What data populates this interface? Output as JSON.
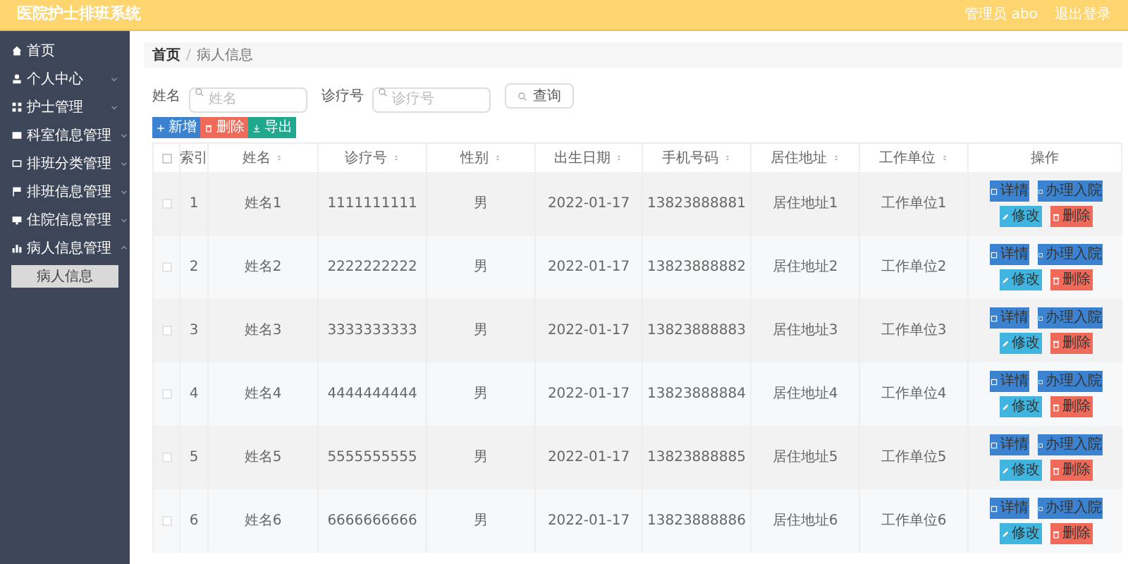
{
  "header": {
    "title": "医院护士排班系统",
    "user": "管理员 abo",
    "logout": "退出登录"
  },
  "sidebar": {
    "items": [
      {
        "label": "首页"
      },
      {
        "label": "个人中心",
        "expanded": false
      },
      {
        "label": "护士管理",
        "expanded": false
      },
      {
        "label": "科室信息管理",
        "expanded": false
      },
      {
        "label": "排班分类管理",
        "expanded": false
      },
      {
        "label": "排班信息管理",
        "expanded": false
      },
      {
        "label": "住院信息管理",
        "expanded": false
      },
      {
        "label": "病人信息管理",
        "expanded": true,
        "children": [
          {
            "label": "病人信息",
            "selected": true
          }
        ]
      }
    ]
  },
  "breadcrumb": {
    "items": [
      "首页",
      "病人信息"
    ],
    "separator": "/"
  },
  "search": {
    "fields": [
      {
        "label": "姓名",
        "placeholder": "姓名"
      },
      {
        "label": "诊疗号",
        "placeholder": "诊疗号"
      }
    ],
    "button": "查询"
  },
  "actions": [
    {
      "label": "新增",
      "kind": "add"
    },
    {
      "label": "删除",
      "kind": "delete"
    },
    {
      "label": "导出",
      "kind": "export"
    }
  ],
  "table": {
    "all_checked": false,
    "columns": [
      {
        "label": "索引",
        "sortable": false
      },
      {
        "label": "姓名",
        "sortable": true
      },
      {
        "label": "诊疗号",
        "sortable": true
      },
      {
        "label": "性别",
        "sortable": true
      },
      {
        "label": "出生日期",
        "sortable": true
      },
      {
        "label": "手机号码",
        "sortable": true
      },
      {
        "label": "居住地址",
        "sortable": true
      },
      {
        "label": "工作单位",
        "sortable": true
      },
      {
        "label": "操作",
        "sortable": false
      }
    ],
    "rows": [
      {
        "checked": false,
        "cells": [
          "1",
          "姓名1",
          "1111111111",
          "男",
          "2022-01-17",
          "13823888881",
          "居住地址1",
          "工作单位1"
        ],
        "buttons": [
          {
            "label": "详情",
            "kind": "detail"
          },
          {
            "label": "办理入院",
            "kind": "admit"
          },
          {
            "label": "修改",
            "kind": "edit"
          },
          {
            "label": "删除",
            "kind": "delete"
          }
        ]
      },
      {
        "checked": false,
        "cells": [
          "2",
          "姓名2",
          "2222222222",
          "男",
          "2022-01-17",
          "13823888882",
          "居住地址2",
          "工作单位2"
        ],
        "buttons": [
          {
            "label": "详情",
            "kind": "detail"
          },
          {
            "label": "办理入院",
            "kind": "admit"
          },
          {
            "label": "修改",
            "kind": "edit"
          },
          {
            "label": "删除",
            "kind": "delete"
          }
        ]
      },
      {
        "checked": false,
        "cells": [
          "3",
          "姓名3",
          "3333333333",
          "男",
          "2022-01-17",
          "13823888883",
          "居住地址3",
          "工作单位3"
        ],
        "buttons": [
          {
            "label": "详情",
            "kind": "detail"
          },
          {
            "label": "办理入院",
            "kind": "admit"
          },
          {
            "label": "修改",
            "kind": "edit"
          },
          {
            "label": "删除",
            "kind": "delete"
          }
        ]
      },
      {
        "checked": false,
        "cells": [
          "4",
          "姓名4",
          "4444444444",
          "男",
          "2022-01-17",
          "13823888884",
          "居住地址4",
          "工作单位4"
        ],
        "buttons": [
          {
            "label": "详情",
            "kind": "detail"
          },
          {
            "label": "办理入院",
            "kind": "admit"
          },
          {
            "label": "修改",
            "kind": "edit"
          },
          {
            "label": "删除",
            "kind": "delete"
          }
        ]
      },
      {
        "checked": false,
        "cells": [
          "5",
          "姓名5",
          "5555555555",
          "男",
          "2022-01-17",
          "13823888885",
          "居住地址5",
          "工作单位5"
        ],
        "buttons": [
          {
            "label": "详情",
            "kind": "detail"
          },
          {
            "label": "办理入院",
            "kind": "admit"
          },
          {
            "label": "修改",
            "kind": "edit"
          },
          {
            "label": "删除",
            "kind": "delete"
          }
        ]
      },
      {
        "checked": false,
        "cells": [
          "6",
          "姓名6",
          "6666666666",
          "男",
          "2022-01-17",
          "13823888886",
          "居住地址6",
          "工作单位6"
        ],
        "buttons": [
          {
            "label": "详情",
            "kind": "detail"
          },
          {
            "label": "办理入院",
            "kind": "admit"
          },
          {
            "label": "修改",
            "kind": "edit"
          },
          {
            "label": "删除",
            "kind": "delete"
          }
        ]
      }
    ]
  }
}
